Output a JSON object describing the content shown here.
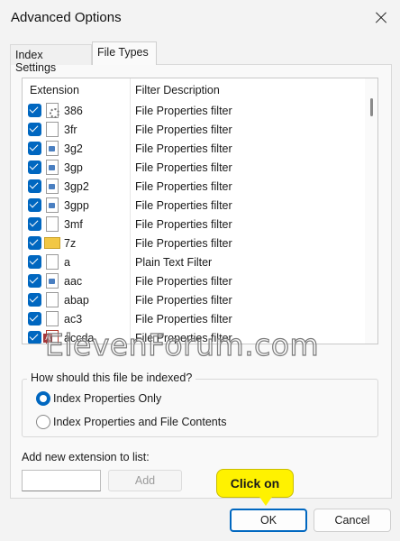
{
  "window": {
    "title": "Advanced Options"
  },
  "tabs": [
    {
      "label": "Index Settings",
      "active": false
    },
    {
      "label": "File Types",
      "active": true
    }
  ],
  "list": {
    "columns": [
      "Extension",
      "Filter Description"
    ],
    "rows": [
      {
        "ext": "386",
        "desc": "File Properties filter",
        "checked": true,
        "icon": "gear-file-icon"
      },
      {
        "ext": "3fr",
        "desc": "File Properties filter",
        "checked": true,
        "icon": "blank-file-icon"
      },
      {
        "ext": "3g2",
        "desc": "File Properties filter",
        "checked": true,
        "icon": "media-file-icon"
      },
      {
        "ext": "3gp",
        "desc": "File Properties filter",
        "checked": true,
        "icon": "media-file-icon"
      },
      {
        "ext": "3gp2",
        "desc": "File Properties filter",
        "checked": true,
        "icon": "media-file-icon"
      },
      {
        "ext": "3gpp",
        "desc": "File Properties filter",
        "checked": true,
        "icon": "media-file-icon"
      },
      {
        "ext": "3mf",
        "desc": "File Properties filter",
        "checked": true,
        "icon": "blank-file-icon"
      },
      {
        "ext": "7z",
        "desc": "File Properties filter",
        "checked": true,
        "icon": "zip-folder-icon"
      },
      {
        "ext": "a",
        "desc": "Plain Text Filter",
        "checked": true,
        "icon": "blank-file-icon"
      },
      {
        "ext": "aac",
        "desc": "File Properties filter",
        "checked": true,
        "icon": "media-file-icon"
      },
      {
        "ext": "abap",
        "desc": "File Properties filter",
        "checked": true,
        "icon": "blank-file-icon"
      },
      {
        "ext": "ac3",
        "desc": "File Properties filter",
        "checked": true,
        "icon": "blank-file-icon"
      },
      {
        "ext": "accda",
        "desc": "File Properties filter",
        "checked": true,
        "icon": "access-file-icon"
      }
    ]
  },
  "index_group": {
    "title": "How should this file be indexed?",
    "options": [
      {
        "label": "Index Properties Only",
        "selected": true
      },
      {
        "label": "Index Properties and File Contents",
        "selected": false
      }
    ]
  },
  "add_extension": {
    "label": "Add new extension to list:",
    "value": "",
    "button": "Add"
  },
  "buttons": {
    "ok": "OK",
    "cancel": "Cancel"
  },
  "callout": {
    "text": "Click on"
  },
  "watermark": {
    "text": "ElevenForum.com"
  },
  "colors": {
    "accent": "#0067c0",
    "callout": "#fff200"
  }
}
